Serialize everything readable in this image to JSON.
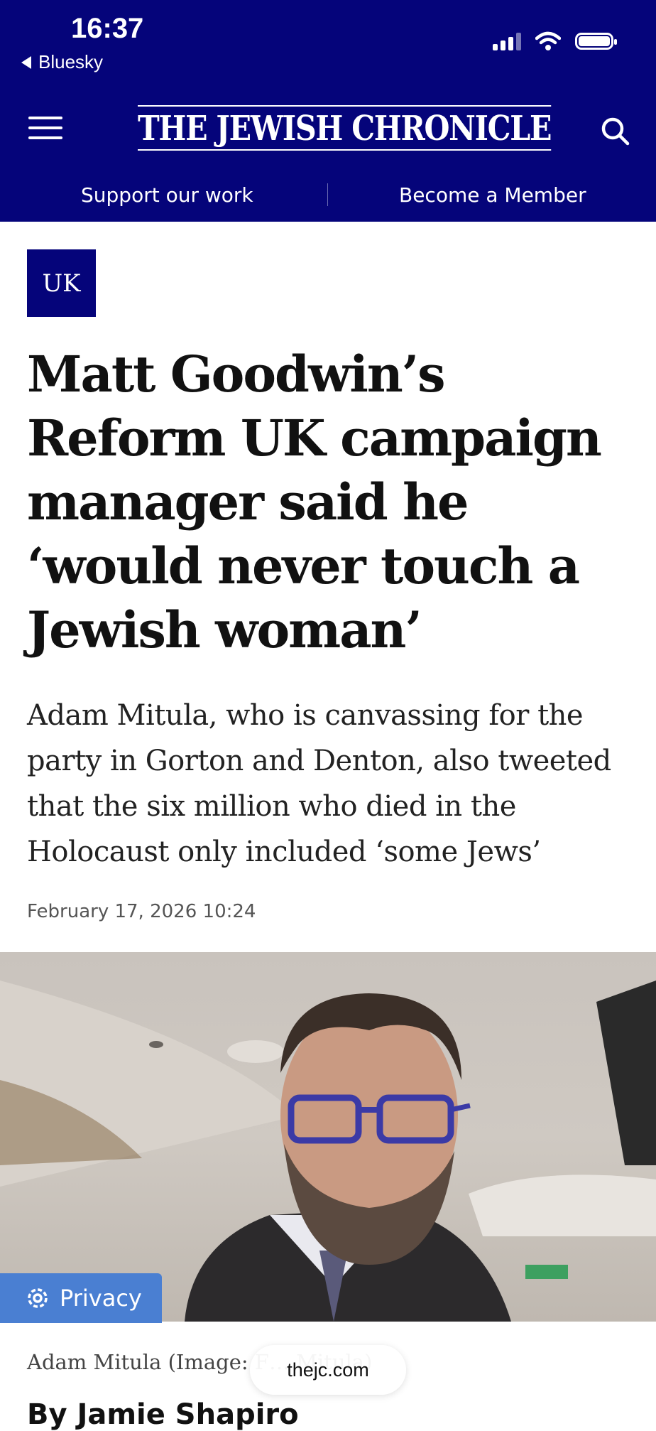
{
  "status_bar": {
    "time": "16:37",
    "back_app": "Bluesky",
    "icons": [
      "cellular-signal-icon",
      "wifi-icon",
      "battery-icon"
    ]
  },
  "header": {
    "logo": "THE JEWISH CHRONICLE",
    "menu_icon": "hamburger-menu-icon",
    "search_icon": "search-icon",
    "support_label": "Support our work",
    "member_label": "Become a Member",
    "brand_color": "#05047a"
  },
  "article": {
    "section_tag": "UK",
    "headline": "Matt Goodwin’s Reform UK campaign manager said he ‘would never touch a Jewish woman’",
    "standfirst": "Adam Mitula, who is canvassing for the party in Gorton and Denton, also tweeted that the six million who died in the Holocaust only included ‘some Jews’",
    "date": "February 17, 2026 10:24",
    "image_caption": "Adam Mitula (Image: F… Mitula)",
    "byline": "By Jamie Shapiro"
  },
  "overlays": {
    "privacy_label": "Privacy",
    "privacy_icon": "gear-icon",
    "privacy_color": "#4a7fd2",
    "url": "thejc.com"
  }
}
